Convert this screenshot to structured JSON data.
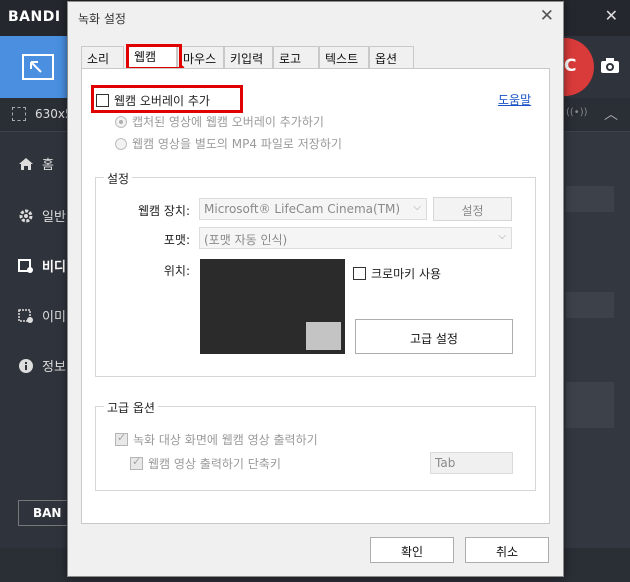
{
  "background_app": {
    "logo": "BANDI",
    "close_glyph": "✕",
    "size_text": "630x5",
    "signal_text": "((•))",
    "up_glyph": "︿",
    "record_letter": "C",
    "sidebar": [
      {
        "label": "홈",
        "icon": "home-icon"
      },
      {
        "label": "일반",
        "icon": "gear-icon"
      },
      {
        "label": "비디",
        "icon": "video-settings-icon"
      },
      {
        "label": "이미",
        "icon": "image-settings-icon"
      },
      {
        "label": "정보",
        "icon": "info-icon"
      }
    ],
    "bottom_button": "BAN"
  },
  "dialog": {
    "title": "녹화 설정",
    "close_glyph": "✕",
    "tabs": [
      {
        "label": "소리"
      },
      {
        "label": "웹캠"
      },
      {
        "label": "마우스"
      },
      {
        "label": "키입력"
      },
      {
        "label": "로고"
      },
      {
        "label": "텍스트"
      },
      {
        "label": "옵션"
      }
    ],
    "active_tab": "웹캠",
    "webcam_overlay": {
      "label": "웹캠 오버레이 추가",
      "checked": false
    },
    "help_link": "도움말",
    "radio_options": [
      {
        "label": "캡처된 영상에 웹캠 오버레이 추가하기",
        "selected": true
      },
      {
        "label": "웹캠 영상을 별도의 MP4 파일로 저장하기",
        "selected": false
      }
    ],
    "settings_group": {
      "title": "설정",
      "device_label": "웹캠 장치:",
      "device_value": "Microsoft® LifeCam Cinema(TM)",
      "device_settings_button": "설정",
      "format_label": "포맷:",
      "format_value": "(포맷 자동 인식)",
      "position_label": "위치:",
      "chroma_key": {
        "label": "크로마키 사용",
        "checked": false
      },
      "advanced_button": "고급 설정"
    },
    "advanced_group": {
      "title": "고급 옵션",
      "output_to_screen": {
        "label": "녹화 대상 화면에 웹캠 영상 출력하기",
        "checked": true
      },
      "shortcut": {
        "label": "웹캠 영상 출력하기 단축키",
        "checked": true
      },
      "shortcut_value": "Tab"
    },
    "ok_button": "확인",
    "cancel_button": "취소"
  },
  "colors": {
    "highlight": "#e00000",
    "link": "#1b53c6",
    "record": "#d93a3a",
    "mode_button": "#4a8fe0"
  }
}
